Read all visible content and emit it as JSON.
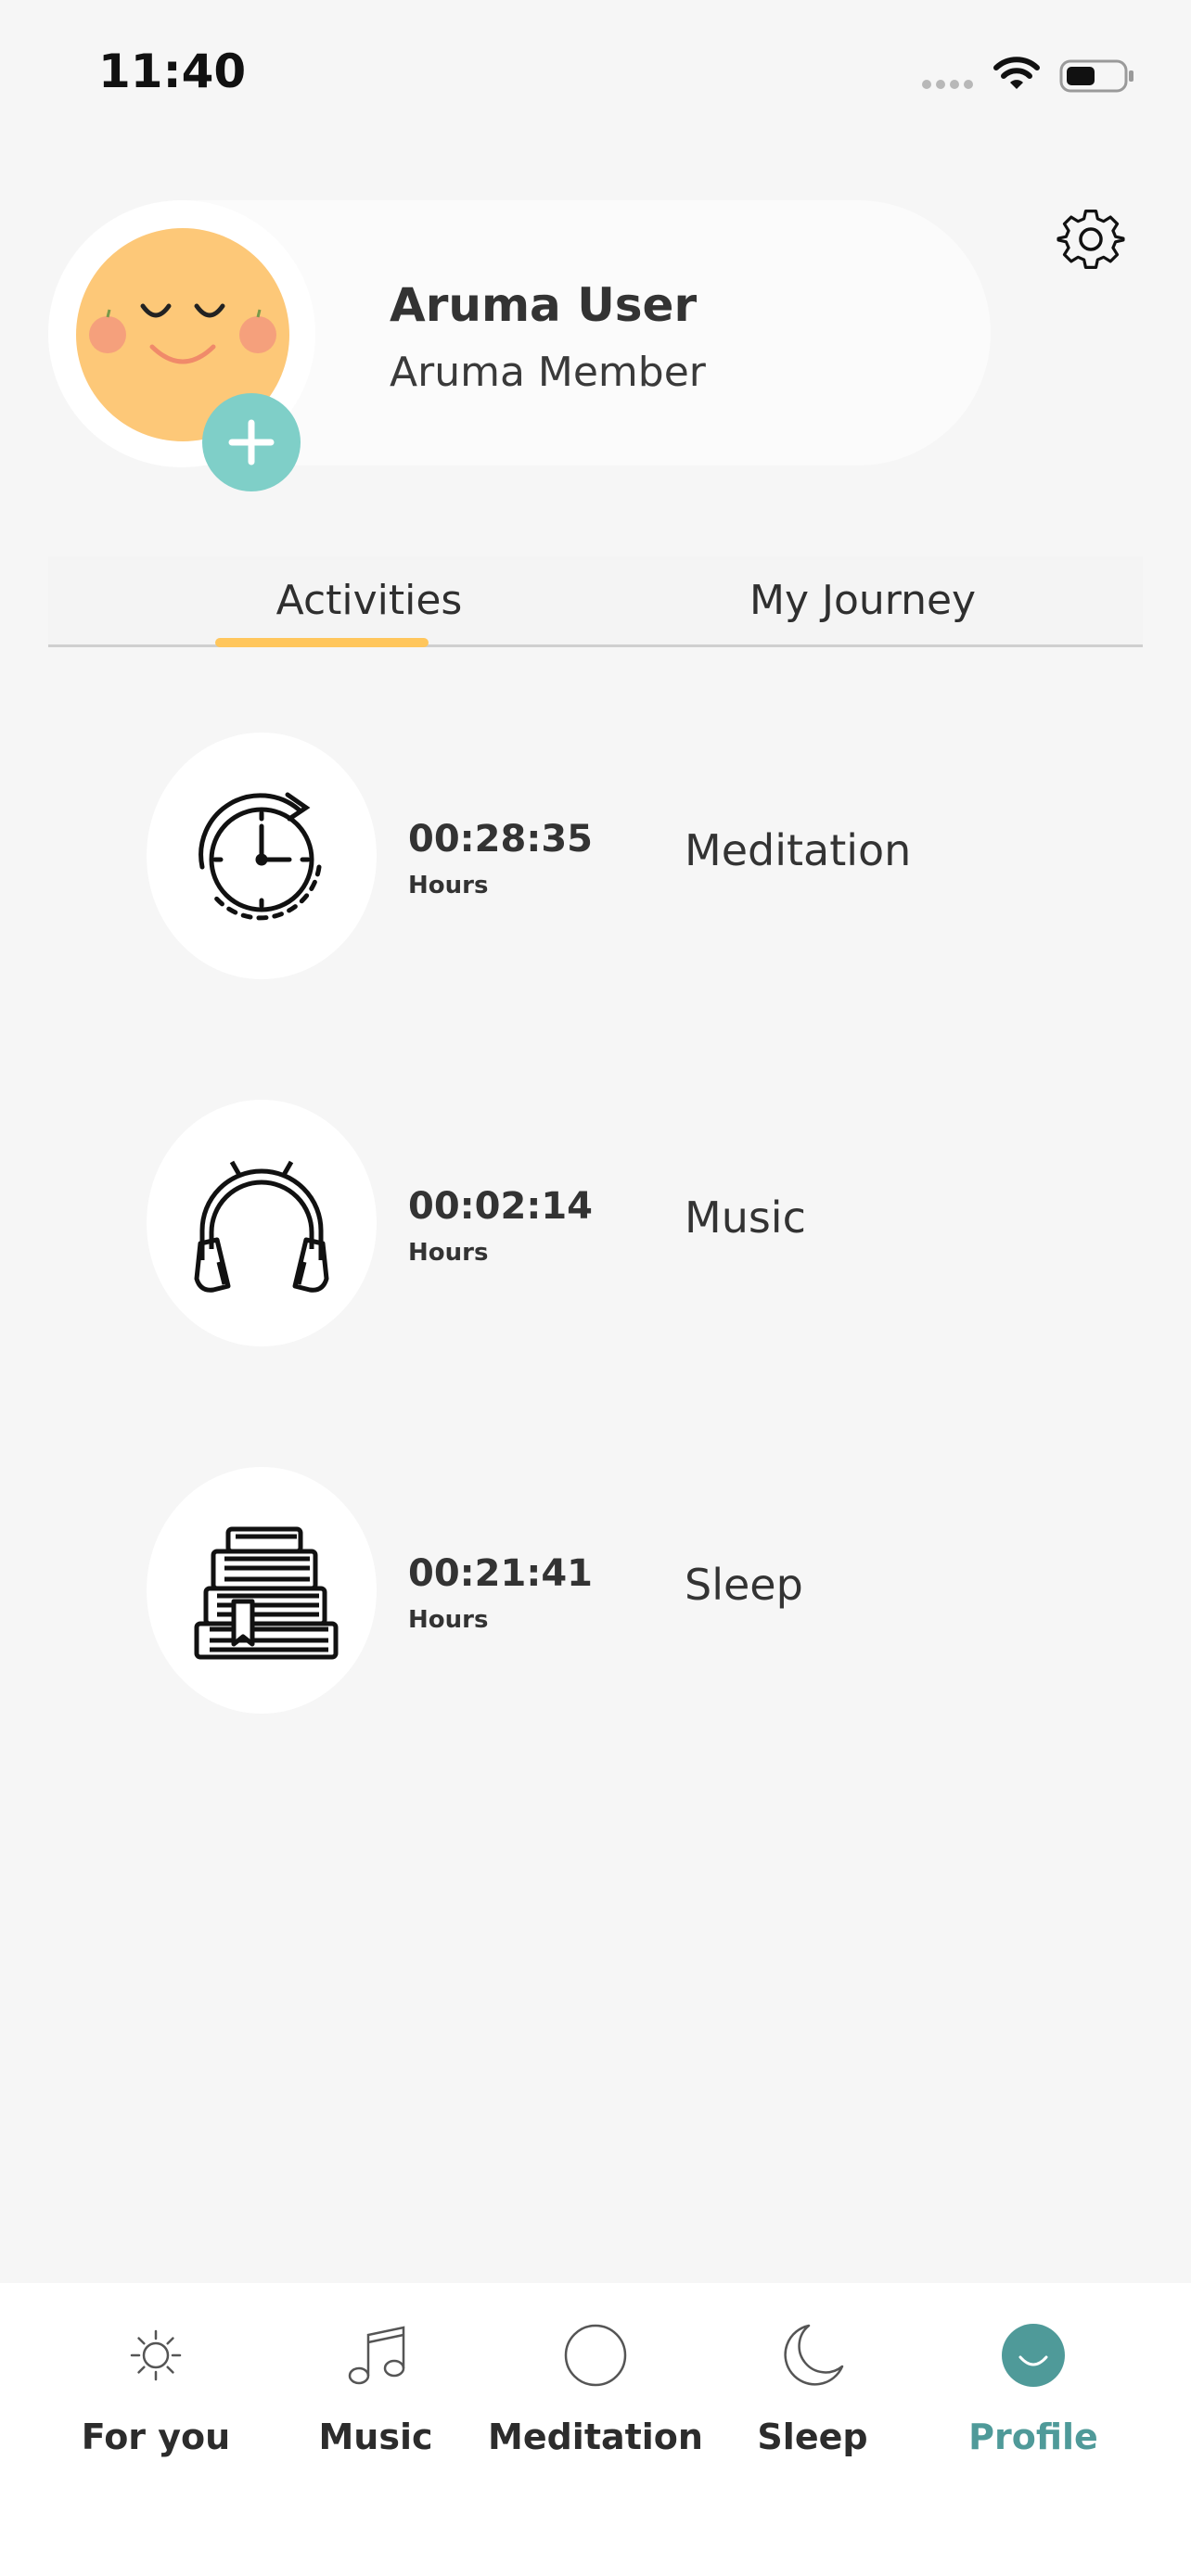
{
  "status_bar": {
    "time": "11:40"
  },
  "profile": {
    "name": "Aruma User",
    "role": "Aruma Member"
  },
  "tabs": [
    {
      "label": "Activities",
      "active": true
    },
    {
      "label": "My Journey",
      "active": false
    }
  ],
  "activities": [
    {
      "time": "00:28:35",
      "unit": "Hours",
      "label": "Meditation",
      "icon": "timer-icon"
    },
    {
      "time": "00:02:14",
      "unit": "Hours",
      "label": "Music",
      "icon": "headphones-icon"
    },
    {
      "time": "00:21:41",
      "unit": "Hours",
      "label": "Sleep",
      "icon": "books-icon"
    }
  ],
  "nav": [
    {
      "label": "For you",
      "icon": "sun-icon"
    },
    {
      "label": "Music",
      "icon": "music-note-icon"
    },
    {
      "label": "Meditation",
      "icon": "circle-icon"
    },
    {
      "label": "Sleep",
      "icon": "moon-icon"
    },
    {
      "label": "Profile",
      "icon": "smile-icon",
      "active": true
    }
  ],
  "colors": {
    "accent_teal": "#4f9a99",
    "tab_indicator": "#ffc65c",
    "avatar_face": "#fdc878",
    "add_button": "#7fcfc8"
  }
}
